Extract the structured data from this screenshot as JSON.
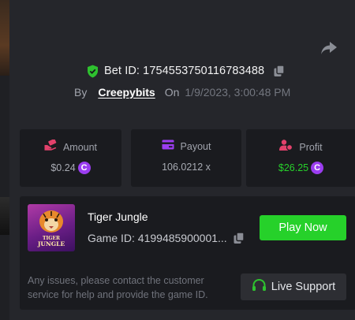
{
  "bet": {
    "label": "Bet ID: 1754553750116783488",
    "by_label": "By",
    "username": "Creepybits",
    "on_label": "On",
    "datetime": "1/9/2023, 3:00:48 PM"
  },
  "stats": {
    "amount": {
      "label": "Amount",
      "value": "$0.24",
      "icon": "wallet-hand-icon",
      "color": "#e2416b"
    },
    "payout": {
      "label": "Payout",
      "value": "106.0212 x",
      "icon": "card-icon",
      "color": "#9b3df0"
    },
    "profit": {
      "label": "Profit",
      "value": "$26.25",
      "icon": "user-coin-icon",
      "color": "#e2416b",
      "value_color": "#27d12b"
    }
  },
  "game": {
    "title": "Tiger Jungle",
    "id_label": "Game ID: 4199485900001...",
    "thumb_text_1": "TIGER",
    "thumb_text_2": "JUNGLE",
    "play_label": "Play Now",
    "note": "Any issues, please contact the customer service for help and provide the game ID.",
    "support_label": "Live Support"
  },
  "currency_symbol": "C",
  "colors": {
    "accent_green": "#26d12a",
    "coin_purple": "#9b3df0",
    "shield_green": "#2ec12f"
  }
}
